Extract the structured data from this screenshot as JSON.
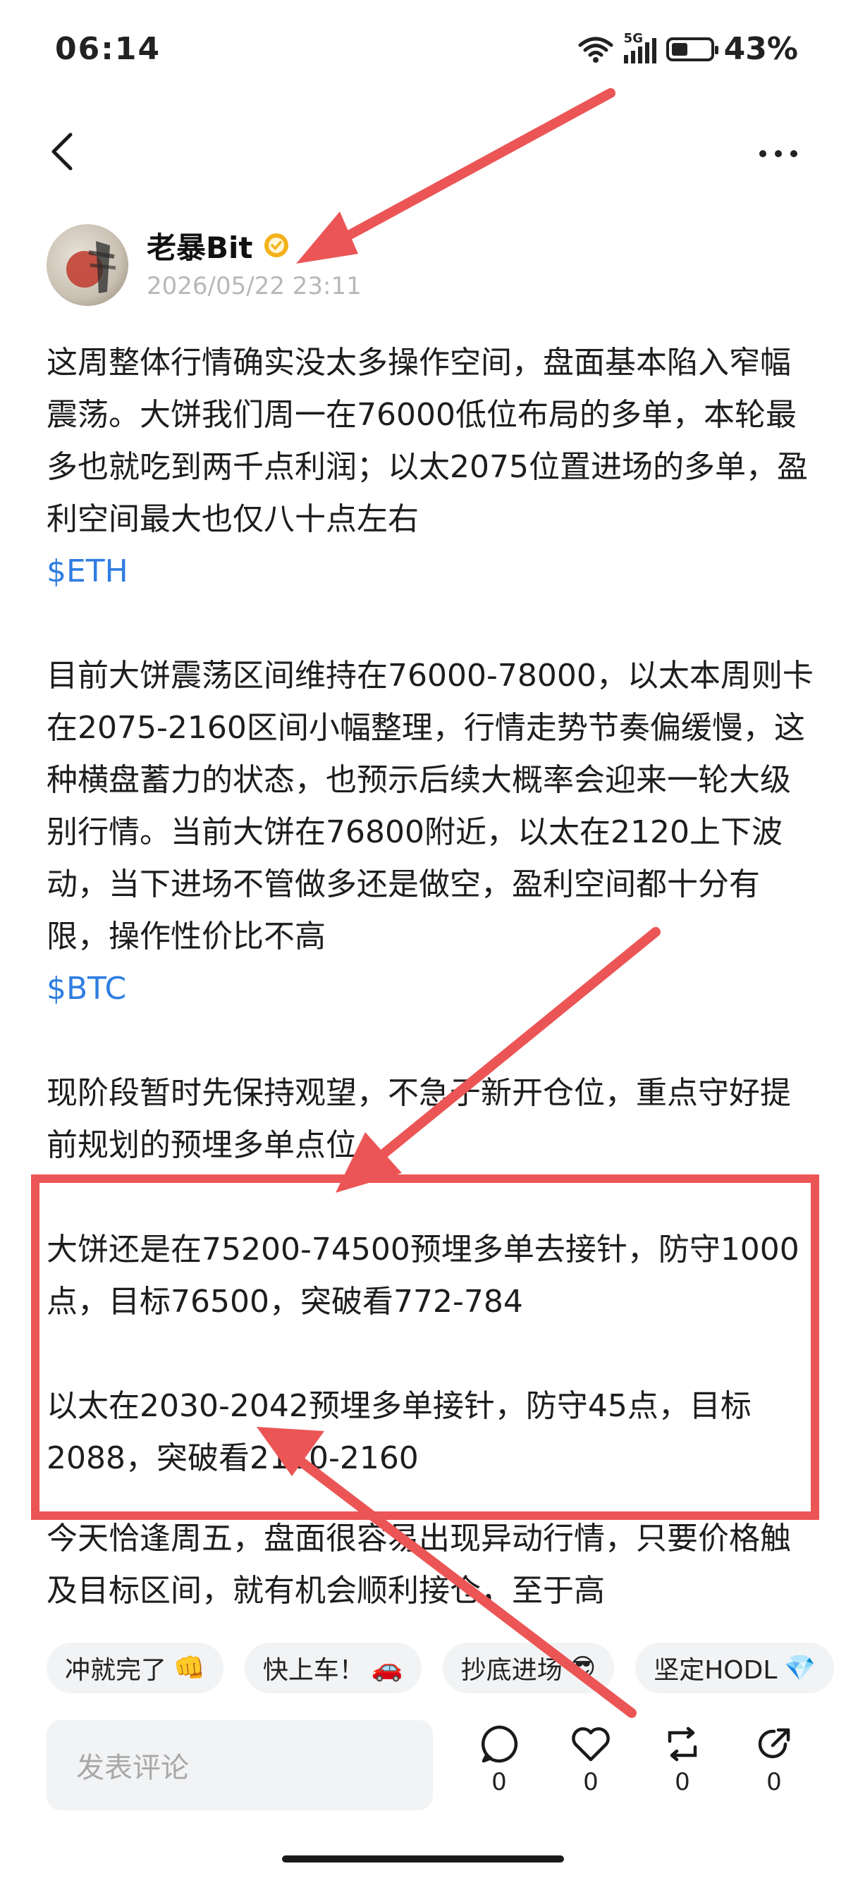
{
  "status_bar": {
    "time": "06:14",
    "signal_label": "5G",
    "battery_percent": "43%",
    "battery_level": 0.43
  },
  "author": {
    "name": "老暴Bit",
    "date": "2026/05/22 23:11"
  },
  "post": {
    "p1": "这周整体行情确实没太多操作空间，盘面基本陷入窄幅震荡。大饼我们周一在76000低位布局的多单，本轮最多也就吃到两千点利润；以太2075位置进场的多单，盈利空间最大也仅八十点左右",
    "tag1": "$ETH",
    "p2": "目前大饼震荡区间维持在76000-78000，以太本周则卡在2075-2160区间小幅整理，行情走势节奏偏缓慢，这种横盘蓄力的状态，也预示后续大概率会迎来一轮大级别行情。当前大饼在76800附近，以太在2120上下波动，当下进场不管做多还是做空，盈利空间都十分有限，操作性价比不高",
    "tag2": "$BTC",
    "p3": "现阶段暂时先保持观望，不急于新开仓位，重点守好提前规划的预埋多单点位。",
    "p4": "大饼还是在75200-74500预埋多单去接针，防守1000点，目标76500，突破看772-784",
    "p5": "以太在2030-2042预埋多单接针，防守45点，目标2088，突破看2120-2160",
    "p6": "今天恰逢周五，盘面很容易出现异动行情，只要价格触及目标区间，就有机会顺利接仓，至于高"
  },
  "quick_replies": [
    {
      "label": "冲就完了",
      "emoji": "👊"
    },
    {
      "label": "快上车！",
      "emoji": "🚗"
    },
    {
      "label": "抄底进场",
      "emoji": "😎"
    },
    {
      "label": "坚定HODL",
      "emoji": "💎"
    }
  ],
  "comment": {
    "placeholder": "发表评论"
  },
  "actions": {
    "comment_count": "0",
    "like_count": "0",
    "repost_count": "0",
    "share_count": "0"
  },
  "colors": {
    "tag": "#2f7de1",
    "highlight": "#ec5555",
    "chip_bg": "#f2f3f5"
  }
}
